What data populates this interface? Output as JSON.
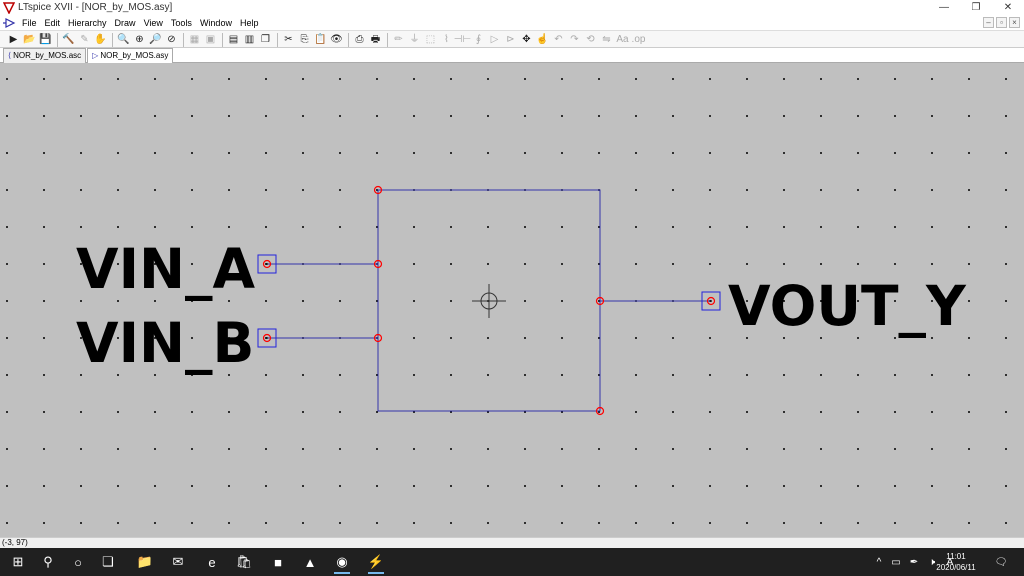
{
  "window": {
    "title": "LTspice XVII - [NOR_by_MOS.asy]",
    "controls": {
      "minimize": "—",
      "maximize": "❐",
      "close": "✕"
    }
  },
  "menu": {
    "items": [
      "File",
      "Edit",
      "Hierarchy",
      "Draw",
      "View",
      "Tools",
      "Window",
      "Help"
    ],
    "mdi_controls": {
      "minimize": "–",
      "restore": "▫",
      "close": "×"
    }
  },
  "toolbar": {
    "icons": [
      {
        "name": "run-icon",
        "glyph": "▶"
      },
      {
        "name": "open-folder-icon",
        "glyph": "📂"
      },
      {
        "name": "save-icon",
        "glyph": "💾"
      },
      {
        "sep": true
      },
      {
        "name": "control-panel-icon",
        "glyph": "🔨"
      },
      {
        "name": "probe-icon",
        "glyph": "✎",
        "disabled": true
      },
      {
        "name": "halt-icon",
        "glyph": "✋",
        "disabled": true
      },
      {
        "sep": true
      },
      {
        "name": "zoom-in-icon",
        "glyph": "🔍"
      },
      {
        "name": "pan-icon",
        "glyph": "⊕"
      },
      {
        "name": "zoom-out-icon",
        "glyph": "🔎"
      },
      {
        "name": "zoom-cancel-icon",
        "glyph": "⊘"
      },
      {
        "sep": true
      },
      {
        "name": "autorange-icon",
        "glyph": "▦",
        "disabled": true
      },
      {
        "name": "zoom-full-icon",
        "glyph": "▣",
        "disabled": true
      },
      {
        "sep": true
      },
      {
        "name": "tile-horizontal-icon",
        "glyph": "▤"
      },
      {
        "name": "tile-vertical-icon",
        "glyph": "▥"
      },
      {
        "name": "cascade-icon",
        "glyph": "❐"
      },
      {
        "sep": true
      },
      {
        "name": "cut-icon",
        "glyph": "✂"
      },
      {
        "name": "copy-icon",
        "glyph": "⎘"
      },
      {
        "name": "paste-icon",
        "glyph": "📋"
      },
      {
        "name": "find-icon",
        "glyph": "👁"
      },
      {
        "sep": true
      },
      {
        "name": "print-icon",
        "glyph": "⎙"
      },
      {
        "name": "print-setup-icon",
        "glyph": "🖶"
      },
      {
        "sep": true
      },
      {
        "name": "wire-icon",
        "glyph": "✏",
        "disabled": true
      },
      {
        "name": "ground-icon",
        "glyph": "⏚",
        "disabled": true
      },
      {
        "name": "label-net-icon",
        "glyph": "⬚",
        "disabled": true
      },
      {
        "name": "resistor-icon",
        "glyph": "⌇",
        "disabled": true
      },
      {
        "name": "capacitor-icon",
        "glyph": "⊣⊢",
        "disabled": true
      },
      {
        "name": "inductor-icon",
        "glyph": "∮",
        "disabled": true
      },
      {
        "name": "diode-icon",
        "glyph": "▷",
        "disabled": true
      },
      {
        "name": "component-icon",
        "glyph": "⊳",
        "disabled": true
      },
      {
        "name": "move-icon",
        "glyph": "✥"
      },
      {
        "name": "drag-icon",
        "glyph": "☝"
      },
      {
        "name": "undo-icon",
        "glyph": "↶",
        "disabled": true
      },
      {
        "name": "redo-icon",
        "glyph": "↷",
        "disabled": true
      },
      {
        "name": "rotate-icon",
        "glyph": "⟲",
        "disabled": true
      },
      {
        "name": "mirror-icon",
        "glyph": "⇋",
        "disabled": true
      },
      {
        "name": "text-icon",
        "glyph": "Aa",
        "disabled": true
      },
      {
        "name": "spice-directive-icon",
        "glyph": ".op",
        "disabled": true
      }
    ]
  },
  "tabs": [
    {
      "label": "NOR_by_MOS.asc",
      "icon": "schematic-icon",
      "glyph": "⟨",
      "active": false
    },
    {
      "label": "NOR_by_MOS.asy",
      "icon": "symbol-icon",
      "glyph": "▷",
      "active": true
    }
  ],
  "symbol": {
    "pins": [
      {
        "label": "VIN_A"
      },
      {
        "label": "VIN_B"
      },
      {
        "label": "VOUT_Y"
      }
    ]
  },
  "status": {
    "coordinates": "(-3, 97)"
  },
  "taskbar": {
    "apps": [
      {
        "name": "windows-start-icon",
        "glyph": "⊞"
      },
      {
        "name": "search-icon",
        "glyph": "⚲"
      },
      {
        "name": "cortana-icon",
        "glyph": "○"
      },
      {
        "name": "task-view-icon",
        "glyph": "❏"
      },
      {
        "name": "file-explorer-icon",
        "glyph": "📁"
      },
      {
        "name": "mail-icon",
        "glyph": "✉"
      },
      {
        "name": "edge-icon",
        "glyph": "e"
      },
      {
        "name": "store-icon",
        "glyph": "🛍"
      },
      {
        "name": "app-red-icon",
        "glyph": "■"
      },
      {
        "name": "vlc-icon",
        "glyph": "▲"
      },
      {
        "name": "chrome-icon",
        "glyph": "◉"
      },
      {
        "name": "ltspice-icon",
        "glyph": "⚡"
      }
    ],
    "tray": {
      "chevron": "^",
      "battery": "▭",
      "pen": "✒",
      "volume": "🕨",
      "ime": "A",
      "notifications": "🗨"
    },
    "time": "11:01",
    "date": "2020/06/11"
  },
  "colors": {
    "canvas": "#c0c0c0",
    "grid_dot": "#000000",
    "wire": "#3333aa",
    "endpoint": "#ff0000",
    "pin_box": "#2222dd",
    "accent": "#76b9ed",
    "taskbar": "#202020"
  }
}
